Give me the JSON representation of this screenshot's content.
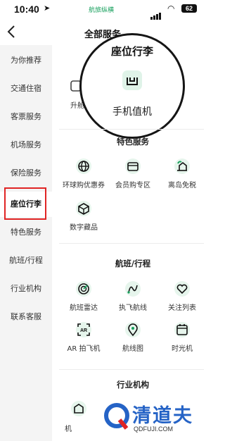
{
  "status_bar": {
    "time": "10:40",
    "brand": "航旅纵横",
    "battery": "62"
  },
  "header": {
    "title": "全部服务"
  },
  "sidebar": {
    "items": [
      {
        "label": "为你推荐"
      },
      {
        "label": "交通住宿"
      },
      {
        "label": "客票服务"
      },
      {
        "label": "机场服务"
      },
      {
        "label": "保险服务"
      },
      {
        "label": "座位行李",
        "active": true
      },
      {
        "label": "特色服务"
      },
      {
        "label": "航班/行程"
      },
      {
        "label": "行业机构"
      },
      {
        "label": "联系客服"
      }
    ]
  },
  "magnifier": {
    "title": "座位行李",
    "item_label": "手机值机",
    "icon": "checkin-bag-icon"
  },
  "peek": {
    "item_label": "升舱"
  },
  "sections": {
    "special": {
      "title": "特色服务",
      "items": [
        {
          "label": "环球购优惠券",
          "icon": "globe-icon"
        },
        {
          "label": "会员购专区",
          "icon": "store-icon"
        },
        {
          "label": "离岛免税",
          "icon": "island-icon"
        },
        {
          "label": "数字藏品",
          "icon": "cube-icon"
        }
      ]
    },
    "flight": {
      "title": "航班/行程",
      "items": [
        {
          "label": "航班雷达",
          "icon": "radar-icon"
        },
        {
          "label": "执飞航线",
          "icon": "route-icon"
        },
        {
          "label": "关注列表",
          "icon": "heart-icon"
        },
        {
          "label": "AR 拍飞机",
          "icon": "ar-icon"
        },
        {
          "label": "航线图",
          "icon": "map-pin-icon"
        },
        {
          "label": "时光机",
          "icon": "calendar-icon"
        }
      ]
    },
    "industry": {
      "title": "行业机构",
      "peek_label": "机"
    }
  },
  "watermark": {
    "text": "清道夫",
    "url": "QDFUJI.COM"
  },
  "colors": {
    "accent": "#17a05d",
    "highlight": "#e02424",
    "watermark": "#2563c6"
  }
}
